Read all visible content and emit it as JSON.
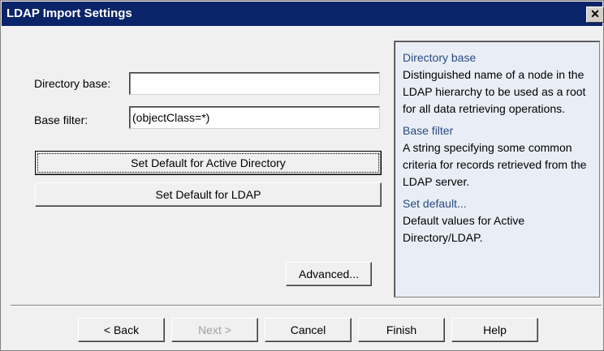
{
  "window": {
    "title": "LDAP Import Settings",
    "close_glyph": "✕"
  },
  "form": {
    "directory_base_label": "Directory base:",
    "directory_base_value": "",
    "base_filter_label": "Base filter:",
    "base_filter_value": "(objectClass=*)"
  },
  "buttons": {
    "set_default_ad": "Set Default for Active Directory",
    "set_default_ldap": "Set Default for LDAP",
    "advanced": "Advanced..."
  },
  "help": {
    "sections": [
      {
        "heading": "Directory base",
        "text": "Distinguished name of a node in the LDAP hierarchy to be used as a root for all data retrieving operations."
      },
      {
        "heading": "Base filter",
        "text": "A string specifying some common criteria for records retrieved from the LDAP server."
      },
      {
        "heading": "Set default...",
        "text": "Default values for Active Directory/LDAP."
      }
    ]
  },
  "footer": {
    "back": "< Back",
    "next": "Next >",
    "cancel": "Cancel",
    "finish": "Finish",
    "help": "Help"
  }
}
